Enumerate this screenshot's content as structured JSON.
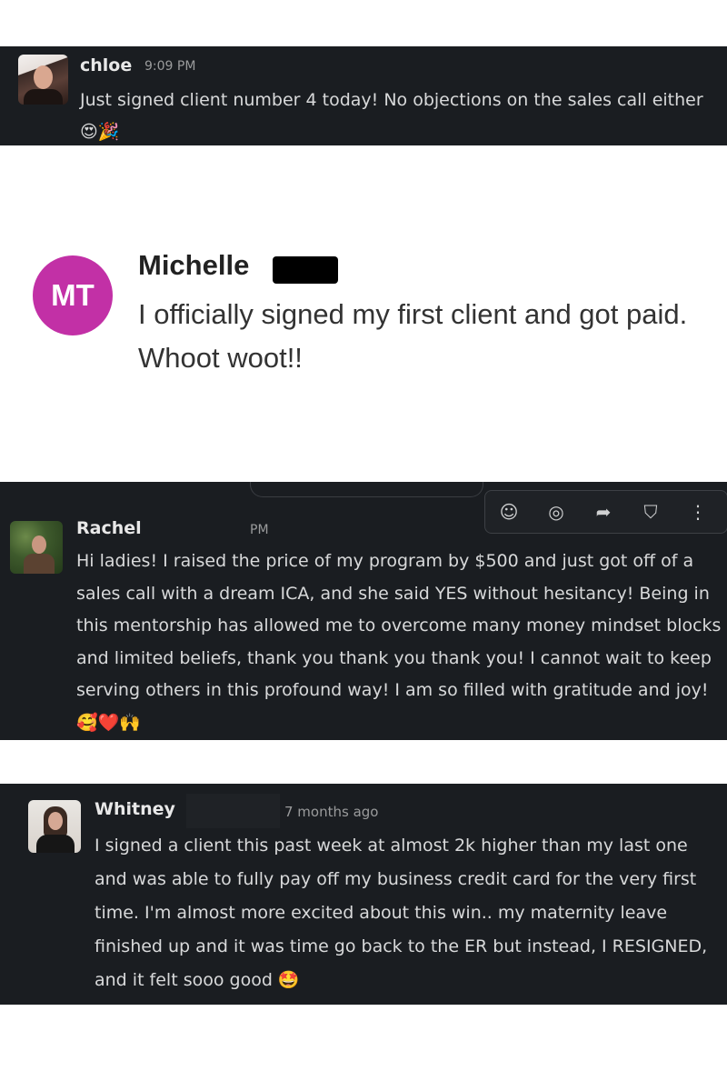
{
  "messages": [
    {
      "author": "chloe",
      "time": "9:09 PM",
      "text": "Just signed client number 4 today!  No objections on the sales call either 😍🎉"
    },
    {
      "author": "Michelle",
      "initials": "MT",
      "avatar_color": "#c230a6",
      "text": "I officially signed my first client and got paid. Whoot woot!!"
    },
    {
      "author": "Rachel",
      "time": "PM",
      "text": "Hi ladies! I raised the price of my program by $500 and just got off of a sales call with a dream ICA, and she said YES without hesitancy! Being in this mentorship has allowed me to overcome many money mindset blocks and limited beliefs, thank you thank you thank you! I cannot wait to keep serving others in this profound way! I am so filled with gratitude and joy! 🥰❤️🙌"
    },
    {
      "author": "Whitney",
      "time": "7 months ago",
      "text": "I signed a client this past week at almost 2k higher than my last one and was able to fully pay off my business credit card for the very first time. I'm almost more excited about this win.. my maternity leave finished up and it was time go back to the ER but instead, I RESIGNED, and it felt sooo good 🤩"
    }
  ],
  "toolbar": {
    "icons": [
      "add-reaction-icon",
      "reply-in-thread-icon",
      "forward-icon",
      "bookmark-icon",
      "more-actions-icon"
    ],
    "glyphs": [
      "☺",
      "◎",
      "➦",
      "⛉",
      "⋮"
    ]
  },
  "colors": {
    "dark_bg": "#1a1d21",
    "text": "#d8d9da",
    "muted": "#9a9b9c"
  }
}
